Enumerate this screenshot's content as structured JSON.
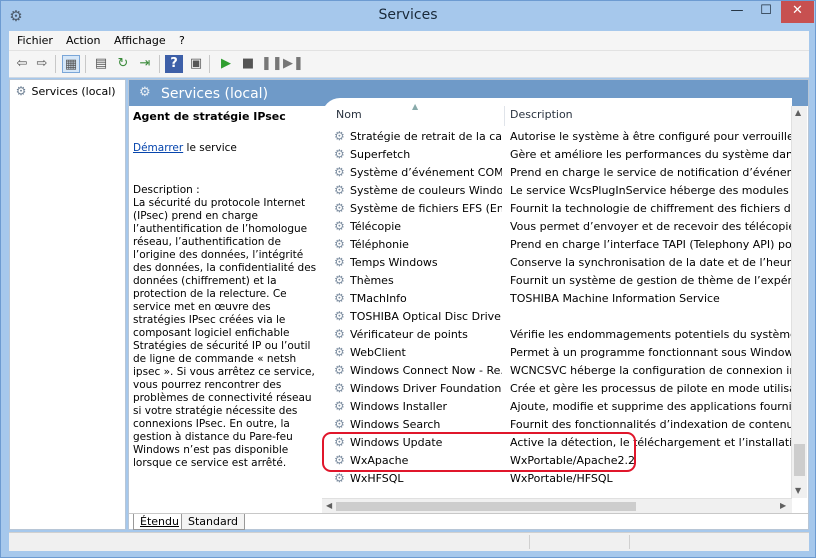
{
  "window": {
    "title": "Services"
  },
  "menu": [
    "Fichier",
    "Action",
    "Affichage",
    "?"
  ],
  "tree": {
    "root_label": "Services (local)"
  },
  "main": {
    "header_title": "Services (local)",
    "selected_service": "Agent de stratégie IPsec",
    "start_link": "Démarrer",
    "start_suffix": " le service",
    "description": "Description :\nLa sécurité du protocole Internet (IPsec) prend en charge l’authentification de l’homologue réseau, l’authentification de l’origine des données, l’intégrité des données, la confidentialité des données (chiffrement) et la protection de la relecture. Ce service met en œuvre des stratégies IPsec créées via le composant logiciel enfichable Stratégies de sécurité IP ou l’outil de ligne de commande « netsh ipsec ». Si vous arrêtez ce service, vous pourrez rencontrer des problèmes de connectivité réseau si votre stratégie nécessite des connexions IPsec. En outre, la gestion à distance du Pare-feu Windows n’est pas disponible lorsque ce service est arrêté."
  },
  "columns": {
    "name": "Nom",
    "description": "Description"
  },
  "rows": [
    {
      "name": "Stratégie de retrait de la carte...",
      "description": "Autorise le système à être configuré pour verrouiller le Bu"
    },
    {
      "name": "Superfetch",
      "description": "Gère et améliore les performances du système dans le ter"
    },
    {
      "name": "Système d’événement COM+",
      "description": "Prend en charge le service de notification d’événements"
    },
    {
      "name": "Système de couleurs Windows",
      "description": "Le service WcsPlugInService héberge des modules de plu"
    },
    {
      "name": "Système de fichiers EFS (Encr...",
      "description": "Fournit la technologie de chiffrement des fichiers de bas"
    },
    {
      "name": "Télécopie",
      "description": "Vous permet d’envoyer et de recevoir des télécopies, d’u"
    },
    {
      "name": "Téléphonie",
      "description": "Prend en charge l’interface TAPI (Telephony API) pour le"
    },
    {
      "name": "Temps Windows",
      "description": "Conserve la synchronisation de la date et de l’heure sur"
    },
    {
      "name": "Thèmes",
      "description": "Fournit un système de gestion de thème de l’expérience"
    },
    {
      "name": "TMachInfo",
      "description": "TOSHIBA Machine Information Service"
    },
    {
      "name": "TOSHIBA Optical Disc Drive ...",
      "description": ""
    },
    {
      "name": "Vérificateur de points",
      "description": "Vérifie les endommagements potentiels du système de fi"
    },
    {
      "name": "WebClient",
      "description": "Permet à un programme fonctionnant sous Windows de"
    },
    {
      "name": "Windows Connect Now - Re...",
      "description": "WCNCSVC héberge la configuration de connexion immé"
    },
    {
      "name": "Windows Driver Foundation ...",
      "description": "Crée et gère les processus de pilote en mode utilisateur. ("
    },
    {
      "name": "Windows Installer",
      "description": "Ajoute, modifie et supprime des applications fournies en"
    },
    {
      "name": "Windows Search",
      "description": "Fournit des fonctionnalités d’indexation de contenu, de n"
    },
    {
      "name": "Windows Update",
      "description": "Active la détection, le téléchargement et l’installation des"
    },
    {
      "name": "WxApache",
      "description": "WxPortable/Apache2.2"
    },
    {
      "name": "WxHFSQL",
      "description": "WxPortable/HFSQL"
    }
  ],
  "tabs": [
    "Étendu",
    "Standard"
  ],
  "accent": "#6f9ac8",
  "highlight_color": "#e0162b"
}
